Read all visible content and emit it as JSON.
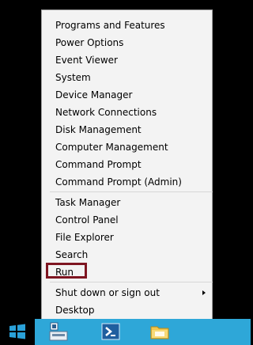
{
  "menu": {
    "group1": [
      "Programs and Features",
      "Power Options",
      "Event Viewer",
      "System",
      "Device Manager",
      "Network Connections",
      "Disk Management",
      "Computer Management",
      "Command Prompt",
      "Command Prompt (Admin)"
    ],
    "group2": [
      "Task Manager",
      "Control Panel",
      "File Explorer",
      "Search",
      "Run"
    ],
    "group3": [
      "Shut down or sign out",
      "Desktop"
    ]
  },
  "taskbar": {
    "start": "windows-logo-icon",
    "icons": [
      "server-manager-icon",
      "powershell-icon",
      "file-explorer-folder-icon"
    ]
  },
  "colors": {
    "menu_bg": "#f3f3f3",
    "highlight": "#7e1521",
    "taskbar": "#2ea7d8",
    "start_logo": "#2aa1d9"
  }
}
